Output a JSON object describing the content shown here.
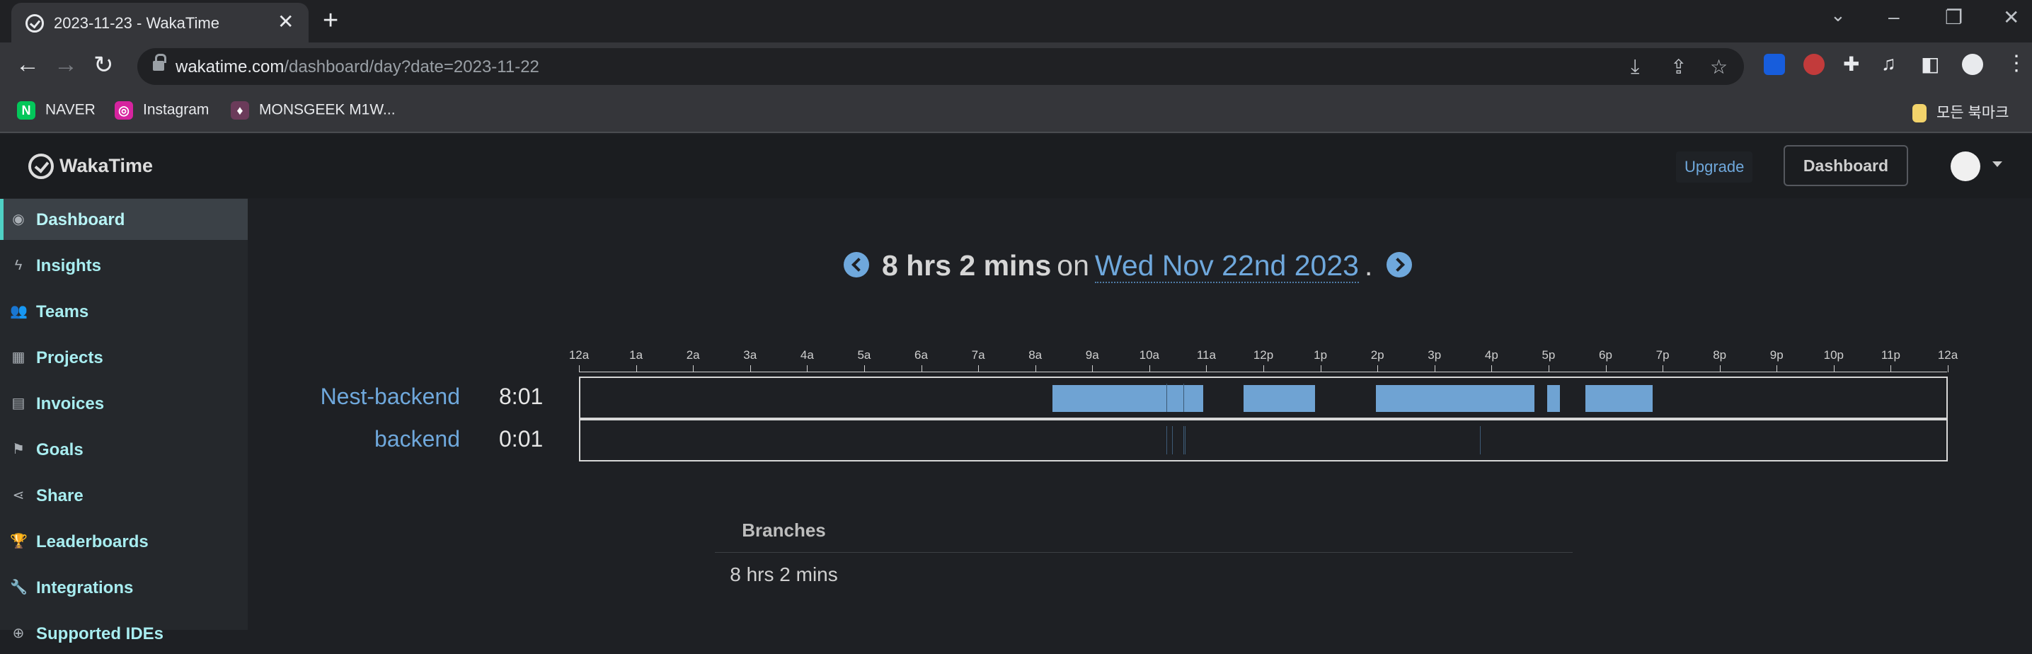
{
  "browser": {
    "tab_title": "2023-11-23 - WakaTime",
    "tab_close": "✕",
    "new_tab": "+",
    "url_host": "wakatime.com",
    "url_path": "/dashboard/day?date=2023-11-22",
    "bookmarks": [
      {
        "label": "NAVER",
        "icon": "naver-icon",
        "color": "#03c75a",
        "glyph": "N"
      },
      {
        "label": "Instagram",
        "icon": "instagram-icon",
        "color": "#d6249f",
        "glyph": "◎"
      },
      {
        "label": "MONSGEEK M1W...",
        "icon": "monsgeek-icon",
        "color": "#6b3b5a",
        "glyph": "♦"
      }
    ],
    "all_bookmarks_label": "모든 북마크"
  },
  "header": {
    "logo": "WakaTime",
    "upgrade": "Upgrade",
    "dashboard_button": "Dashboard"
  },
  "sidebar": {
    "items": [
      {
        "label": "Dashboard",
        "icon": "dashboard-icon",
        "glyph": "◉",
        "active": true
      },
      {
        "label": "Insights",
        "icon": "bolt-icon",
        "glyph": "ϟ"
      },
      {
        "label": "Teams",
        "icon": "users-icon",
        "glyph": "👥"
      },
      {
        "label": "Projects",
        "icon": "grid-icon",
        "glyph": "▦"
      },
      {
        "label": "Invoices",
        "icon": "invoice-icon",
        "glyph": "▤"
      },
      {
        "label": "Goals",
        "icon": "flag-icon",
        "glyph": "⚑"
      },
      {
        "label": "Share",
        "icon": "share-icon",
        "glyph": "⋖"
      },
      {
        "label": "Leaderboards",
        "icon": "trophy-icon",
        "glyph": "🏆"
      },
      {
        "label": "Integrations",
        "icon": "wrench-icon",
        "glyph": "🔧"
      },
      {
        "label": "Supported IDEs",
        "icon": "plus-circle-icon",
        "glyph": "⊕"
      }
    ]
  },
  "summary": {
    "duration": "8 hrs 2 mins",
    "on": "on",
    "date": "Wed Nov 22nd 2023",
    "period": "."
  },
  "timeline": {
    "hour_labels": [
      "12a",
      "1a",
      "2a",
      "3a",
      "4a",
      "5a",
      "6a",
      "7a",
      "8a",
      "9a",
      "10a",
      "11a",
      "12p",
      "1p",
      "2p",
      "3p",
      "4p",
      "5p",
      "6p",
      "7p",
      "8p",
      "9p",
      "10p",
      "11p",
      "12a"
    ],
    "projects": [
      {
        "name": "Nest-backend",
        "time": "8:01",
        "segments_hours": [
          [
            8.3,
            10.95
          ],
          [
            11.65,
            12.9
          ],
          [
            13.97,
            16.75
          ],
          [
            16.98,
            17.2
          ],
          [
            17.65,
            18.83
          ]
        ],
        "thin_marks_hours": [
          10.3,
          10.6
        ]
      },
      {
        "name": "backend",
        "time": "0:01",
        "segments_hours": [],
        "thin_marks_hours": [
          10.3,
          10.4,
          10.6,
          10.62,
          15.8
        ]
      }
    ],
    "bar_color": "#6fa3d3"
  },
  "branches": {
    "title": "Branches",
    "total": "8 hrs 2 mins"
  }
}
